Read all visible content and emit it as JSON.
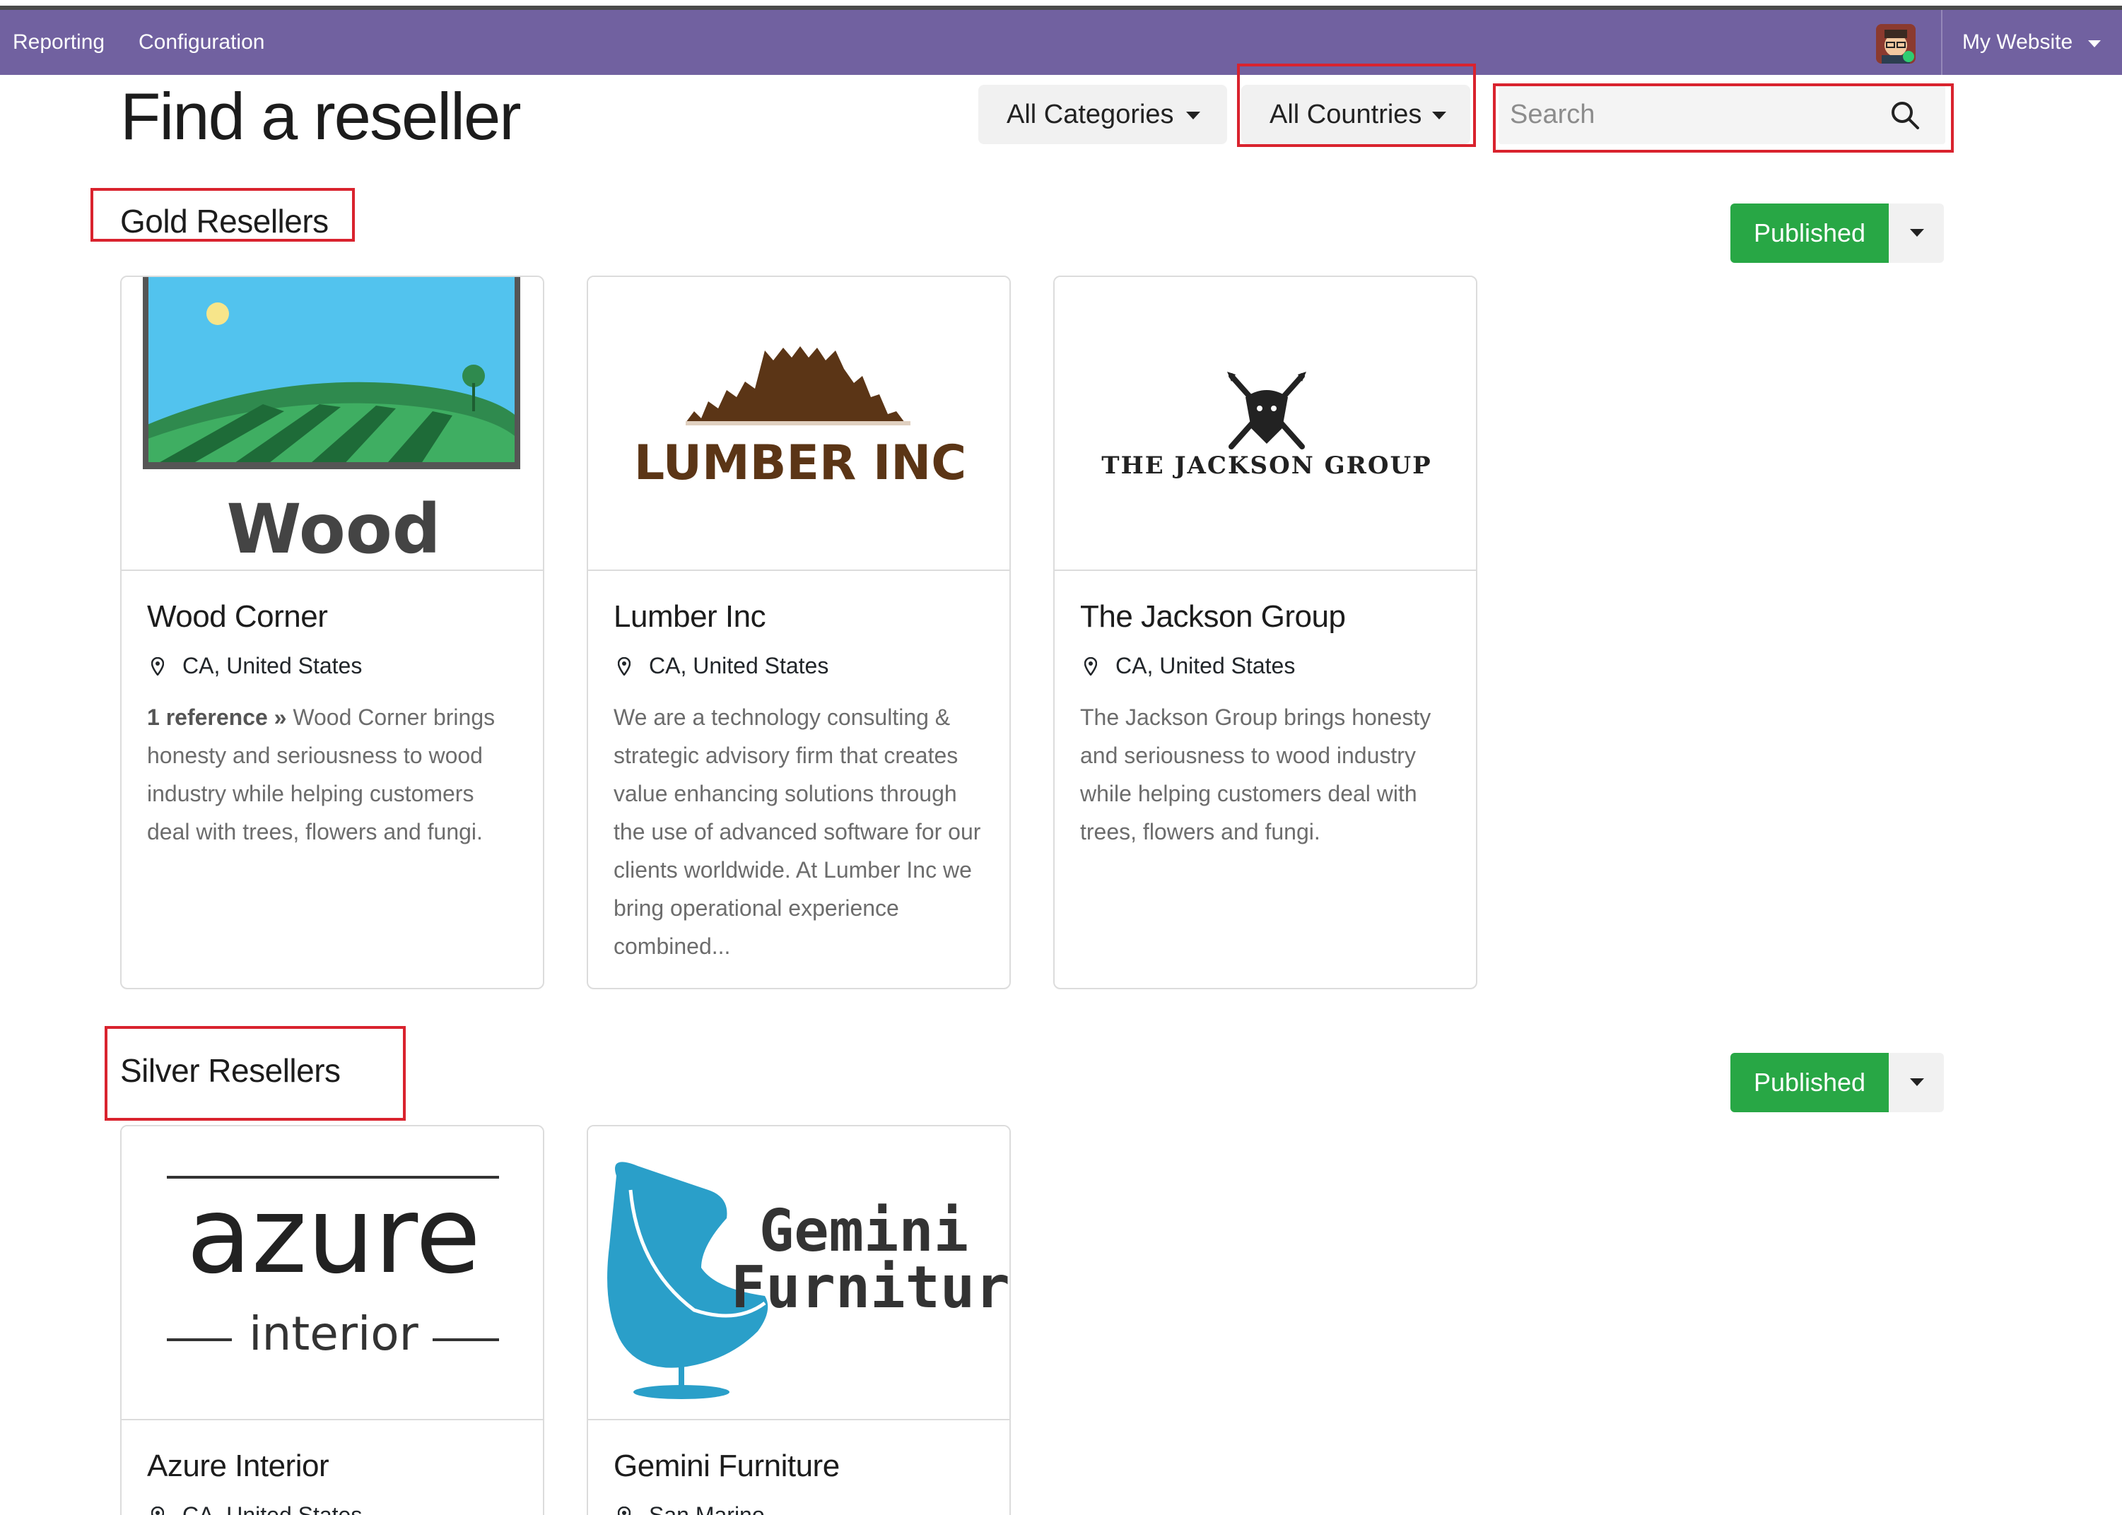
{
  "navbar": {
    "items": [
      "Reporting",
      "Configuration"
    ],
    "website_label": "My Website"
  },
  "header": {
    "title": "Find a reseller",
    "categories_label": "All Categories",
    "countries_label": "All Countries",
    "search_placeholder": "Search"
  },
  "sections": [
    {
      "title": "Gold Resellers",
      "publish_label": "Published",
      "cards": [
        {
          "name": "Wood Corner",
          "location": "CA, United States",
          "reference": "1 reference »",
          "description": "Wood Corner brings honesty and seriousness to wood industry while helping customers deal with trees, flowers and fungi.",
          "logo_text": "Wood"
        },
        {
          "name": "Lumber Inc",
          "location": "CA, United States",
          "description": "We are a technology consulting & strategic advisory firm that creates value enhancing solutions through the use of advanced software for our clients worldwide. At Lumber Inc we bring operational experience combined...",
          "logo_text": "LUMBER INC"
        },
        {
          "name": "The Jackson Group",
          "location": "CA, United States",
          "description": "The Jackson Group brings honesty and seriousness to wood industry while helping customers deal with trees, flowers and fungi.",
          "logo_text": "THE JACKSON GROUP"
        }
      ]
    },
    {
      "title": "Silver Resellers",
      "publish_label": "Published",
      "cards": [
        {
          "name": "Azure Interior",
          "location": "CA, United States",
          "logo_text": "azure",
          "logo_subtext": "interior"
        },
        {
          "name": "Gemini Furniture",
          "location": "San Marino",
          "logo_text": "Gemini",
          "logo_subtext": "Furniture"
        }
      ]
    }
  ],
  "colors": {
    "navbar": "#7161a0",
    "published": "#28a745",
    "annotation": "#d9232e"
  },
  "icons": [
    "avatar",
    "search-icon",
    "map-marker-icon",
    "caret-down-icon"
  ]
}
